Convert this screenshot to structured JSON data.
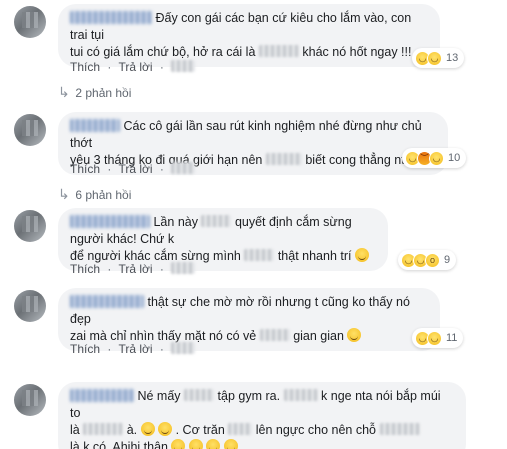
{
  "comments": [
    {
      "text_parts": [
        "Đấy con gái các bạn cứ kiêu cho lắm vào, con trai tụi",
        "tui có giá lắm chứ bộ, hở ra cái là",
        "khác nó hốt ngay !!!"
      ],
      "actions": {
        "like": "Thích",
        "reply": "Trả lời",
        "time": "1 năm"
      },
      "reactions": {
        "types": [
          "haha",
          "haha"
        ],
        "count": "13"
      },
      "replies_label": "2 phản hồi"
    },
    {
      "text_parts": [
        "Các cô gái lần sau rút kinh nghiệm nhé đừng như chủ thớt",
        "yêu 3 tháng ko đi quá giới hạn nên",
        "biết cong thẳng ntn :))"
      ],
      "actions": {
        "like": "Thích",
        "reply": "Trả lời",
        "time": "1 năm"
      },
      "reactions": {
        "types": [
          "haha",
          "angry",
          "haha"
        ],
        "count": "10"
      },
      "replies_label": "6 phản hồi"
    },
    {
      "text_parts": [
        "Lần này",
        "quyết định cắm sừng người khác! Chứ k",
        "để người khác cắm sừng mình",
        "thật nhanh trí"
      ],
      "actions": {
        "like": "Thích",
        "reply": "Trả lời",
        "time": "1 năm"
      },
      "reactions": {
        "types": [
          "haha",
          "haha",
          "wow"
        ],
        "count": "9"
      }
    },
    {
      "text_parts": [
        "thật sự che mờ mờ rồi nhưng t cũng ko thấy nó đẹp",
        "zai mà chỉ nhìn thấy mặt nó có vẻ",
        "gian gian"
      ],
      "actions": {
        "like": "Thích",
        "reply": "Trả lời",
        "time": "1 năm"
      },
      "reactions": {
        "types": [
          "haha",
          "haha"
        ],
        "count": "11"
      }
    },
    {
      "text_parts": [
        "Né mấy",
        "tập gym ra.",
        "k nge nta nói bắp múi to",
        "là",
        "à.",
        ". Cơ trăn",
        "lên ngực cho nên chỗ",
        "là k có. Ahihi thân"
      ]
    }
  ],
  "colors": {
    "bubble": "#f2f3f5",
    "meta": "#606770",
    "text": "#1c1e21"
  }
}
